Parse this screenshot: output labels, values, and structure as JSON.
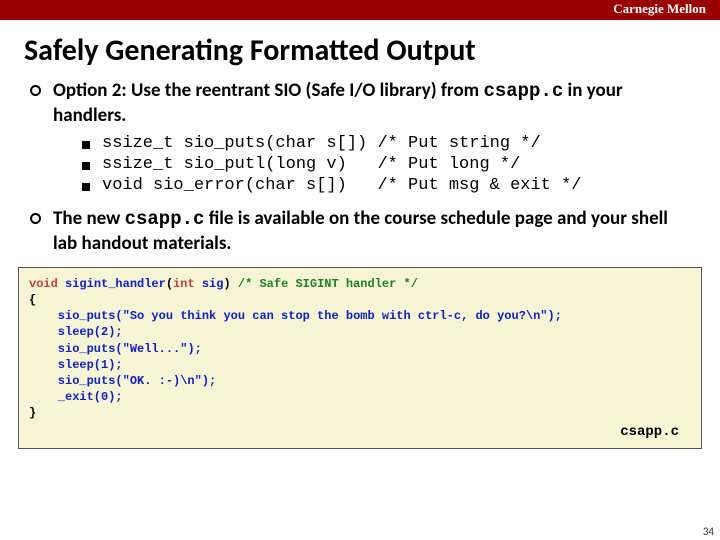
{
  "header": {
    "institution": "Carnegie Mellon"
  },
  "slide": {
    "title": "Safely Generating Formatted Output",
    "bullets": [
      {
        "pre": "Option 2: Use the reentrant SIO (Safe I/O library) from ",
        "code": "csapp.c",
        "post": " in your handlers."
      },
      {
        "pre": "The new ",
        "code": "csapp.c",
        "post": " file is available on the course schedule page and your shell lab handout materials."
      }
    ],
    "sub_items": [
      "ssize_t sio_puts(char s[]) /* Put string */",
      "ssize_t sio_putl(long v)   /* Put long */",
      "void sio_error(char s[])   /* Put msg & exit */"
    ]
  },
  "code": {
    "kw_void": "void",
    "fn_name": " sigint_handler",
    "paren_open": "(",
    "kw_int": "int",
    "arg": " sig",
    "paren_close": ") ",
    "cmt": "/* Safe SIGINT handler */",
    "brace_open": "{",
    "line1a": "    sio_puts(",
    "line1b": "\"So you think you can stop the bomb with ctrl-c, do you?\\n\"",
    "line1c": ");",
    "line2": "    sleep(2);",
    "line3a": "    sio_puts(",
    "line3b": "\"Well...\"",
    "line3c": ");",
    "line4": "    sleep(1);",
    "line5a": "    sio_puts(",
    "line5b": "\"OK. :-)\\n\"",
    "line5c": ");",
    "line6": "    _exit(0);",
    "brace_close": "}",
    "caption": "csapp.c"
  },
  "page": "34"
}
